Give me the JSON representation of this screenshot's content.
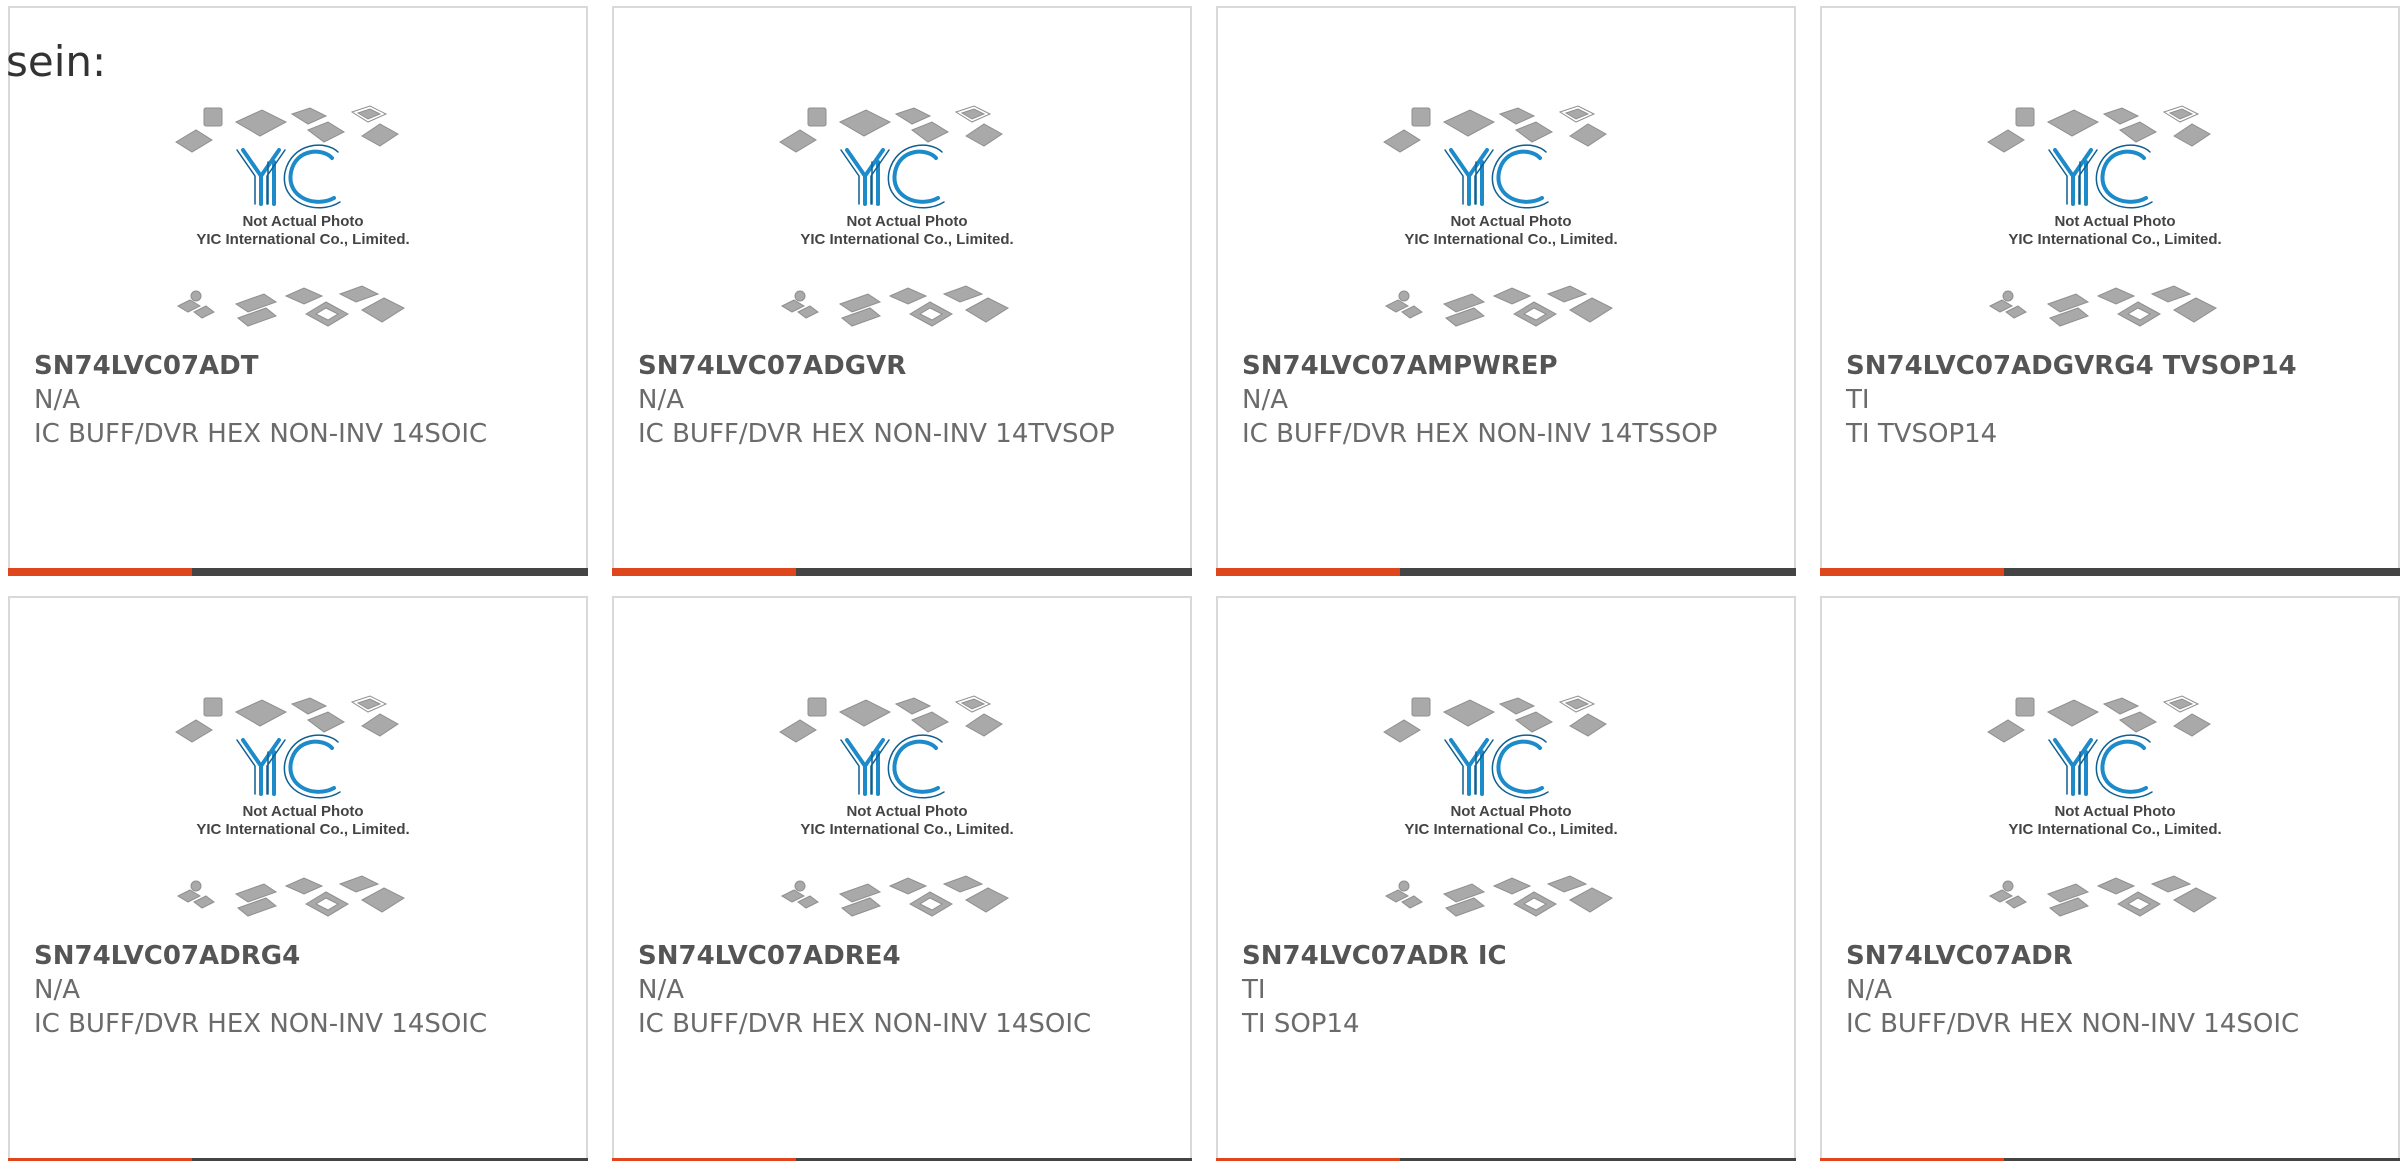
{
  "page": {
    "lead_text": "sein:"
  },
  "placeholder_photo": {
    "line1": "Not Actual Photo",
    "line2": "YIC International Co., Limited.",
    "logo_text": "YIC"
  },
  "accent_colors": {
    "bar_accent": "#e0461d",
    "bar_base": "#444444",
    "logo_blue": "#1d8ac9"
  },
  "products": [
    {
      "part_no": "SN74LVC07ADT",
      "manufacturer": "N/A",
      "description": "IC BUFF/DVR HEX NON-INV 14SOIC"
    },
    {
      "part_no": "SN74LVC07ADGVR",
      "manufacturer": "N/A",
      "description": "IC BUFF/DVR HEX NON-INV 14TVSOP"
    },
    {
      "part_no": "SN74LVC07AMPWREP",
      "manufacturer": "N/A",
      "description": "IC BUFF/DVR HEX NON-INV 14TSSOP"
    },
    {
      "part_no": "SN74LVC07ADGVRG4 TVSOP14",
      "manufacturer": "TI",
      "description": "TI TVSOP14"
    },
    {
      "part_no": "SN74LVC07ADRG4",
      "manufacturer": "N/A",
      "description": "IC BUFF/DVR HEX NON-INV 14SOIC"
    },
    {
      "part_no": "SN74LVC07ADRE4",
      "manufacturer": "N/A",
      "description": "IC BUFF/DVR HEX NON-INV 14SOIC"
    },
    {
      "part_no": "SN74LVC07ADR IC",
      "manufacturer": "TI",
      "description": "TI SOP14"
    },
    {
      "part_no": "SN74LVC07ADR",
      "manufacturer": "N/A",
      "description": "IC BUFF/DVR HEX NON-INV 14SOIC"
    }
  ]
}
